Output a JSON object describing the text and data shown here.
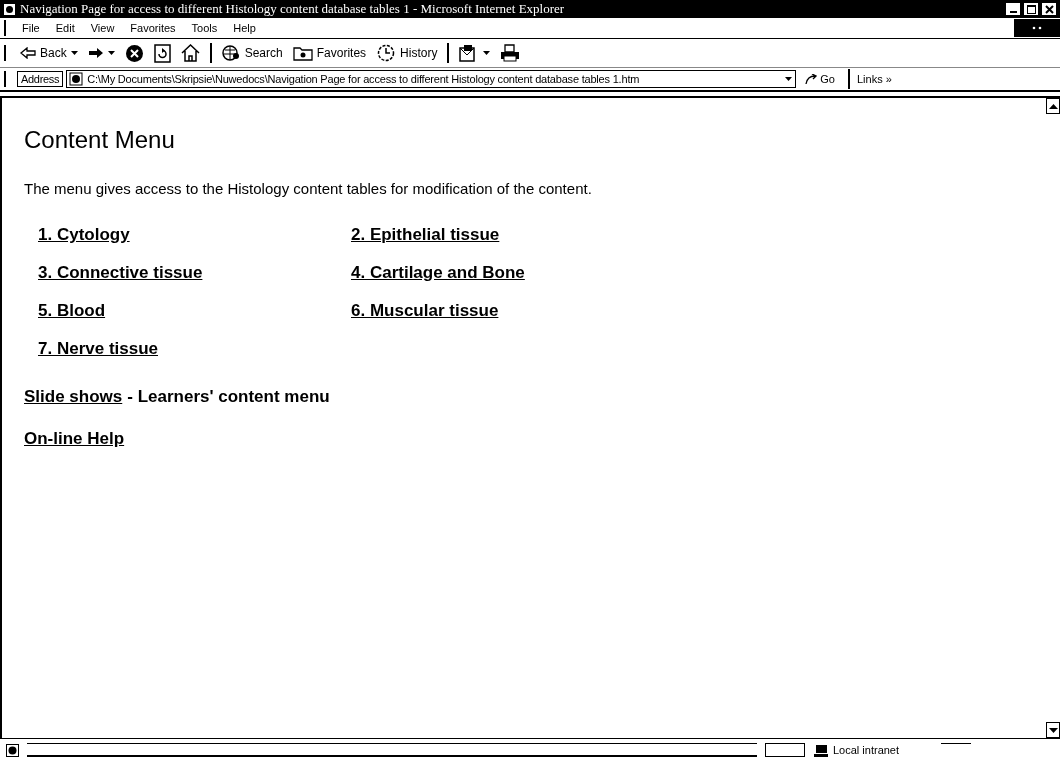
{
  "window": {
    "title": "Navigation Page for access to different Histology content database tables 1 - Microsoft Internet Explorer"
  },
  "menu": [
    "File",
    "Edit",
    "View",
    "Favorites",
    "Tools",
    "Help"
  ],
  "toolbar": {
    "groups": [
      [
        {
          "kind": "back",
          "label": "Back",
          "dropdown": true
        },
        {
          "kind": "forward",
          "dropdown": true
        },
        {
          "kind": "stop"
        },
        {
          "kind": "refresh"
        },
        {
          "kind": "home"
        }
      ],
      [
        {
          "kind": "search",
          "label": "Search"
        },
        {
          "kind": "favorites",
          "label": "Favorites"
        },
        {
          "kind": "history",
          "label": "History"
        }
      ],
      [
        {
          "kind": "mail",
          "dropdown": true
        },
        {
          "kind": "print"
        }
      ]
    ]
  },
  "address_bar": {
    "label": "Address",
    "value": "C:\\My Documents\\Skripsie\\Nuwedocs\\Navigation Page for access to different Histology content database tables 1.htm",
    "go": "Go",
    "links": "Links »"
  },
  "page": {
    "heading": "Content Menu",
    "intro": "The menu gives access to the Histology content tables for modification of the content.",
    "menu_links": [
      "1. Cytology",
      "2. Epithelial tissue",
      "3. Connective tissue",
      "4. Cartilage and Bone",
      "5. Blood",
      "6. Muscular tissue",
      "7. Nerve tissue"
    ],
    "slide_link": "Slide shows",
    "slide_text": "- Learners' content menu",
    "help_link": "On-line Help"
  },
  "status_bar": {
    "zone": "Local intranet"
  }
}
